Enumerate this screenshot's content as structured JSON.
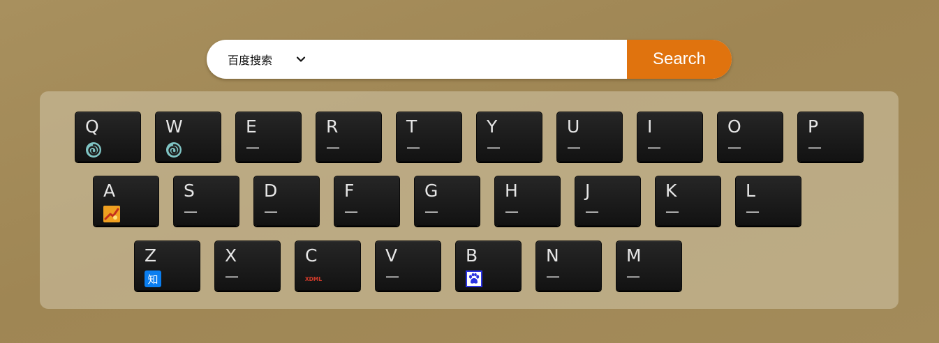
{
  "search": {
    "engine_selected": "百度搜索",
    "query": "",
    "button_label": "Search"
  },
  "colors": {
    "background": "#a08857",
    "keyboard_panel": "#b8a785",
    "search_button": "#e0730e",
    "key_face": "#1c1c1c"
  },
  "keyboard": {
    "rows": [
      [
        {
          "letter": "Q",
          "icon": "spiral-logo-icon"
        },
        {
          "letter": "W",
          "icon": "spiral-logo-icon"
        },
        {
          "letter": "E",
          "shortcut": "—"
        },
        {
          "letter": "R",
          "shortcut": "—"
        },
        {
          "letter": "T",
          "shortcut": "—"
        },
        {
          "letter": "Y",
          "shortcut": "—"
        },
        {
          "letter": "U",
          "shortcut": "—"
        },
        {
          "letter": "I",
          "shortcut": "—"
        },
        {
          "letter": "O",
          "shortcut": "—"
        },
        {
          "letter": "P",
          "shortcut": "—"
        }
      ],
      [
        {
          "letter": "A",
          "icon": "orange-logo-icon"
        },
        {
          "letter": "S",
          "shortcut": "—"
        },
        {
          "letter": "D",
          "shortcut": "—"
        },
        {
          "letter": "F",
          "shortcut": "—"
        },
        {
          "letter": "G",
          "shortcut": "—"
        },
        {
          "letter": "H",
          "shortcut": "—"
        },
        {
          "letter": "J",
          "shortcut": "—"
        },
        {
          "letter": "K",
          "shortcut": "—"
        },
        {
          "letter": "L",
          "shortcut": "—"
        }
      ],
      [
        {
          "letter": "Z",
          "icon": "zhihu-icon",
          "icon_text": "知"
        },
        {
          "letter": "X",
          "shortcut": "—"
        },
        {
          "letter": "C",
          "icon": "xdml-logo-icon",
          "icon_text": "XDML"
        },
        {
          "letter": "V",
          "shortcut": "—"
        },
        {
          "letter": "B",
          "icon": "baidu-paw-icon"
        },
        {
          "letter": "N",
          "shortcut": "—"
        },
        {
          "letter": "M",
          "shortcut": "—"
        }
      ]
    ]
  }
}
